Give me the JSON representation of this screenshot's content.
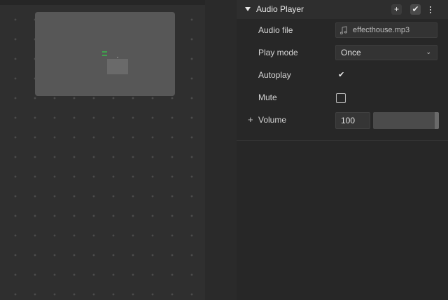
{
  "panel": {
    "title": "Audio Player",
    "header_add_glyph": "+",
    "header_check_glyph": "✔",
    "rows": {
      "audio_file": {
        "label": "Audio file",
        "value": "effecthouse.mp3",
        "icon": "music-note-icon"
      },
      "play_mode": {
        "label": "Play mode",
        "value": "Once",
        "chevron": "⌄"
      },
      "autoplay": {
        "label": "Autoplay",
        "checked": true,
        "check_glyph": "✔"
      },
      "mute": {
        "label": "Mute",
        "checked": false
      },
      "volume": {
        "label": "Volume",
        "expand_glyph": "+",
        "value": "100",
        "level": 100
      }
    }
  },
  "colors": {
    "accent_green": "#3fa34d",
    "panel_bg": "#272727",
    "canvas_bg": "#2f2f2f"
  }
}
